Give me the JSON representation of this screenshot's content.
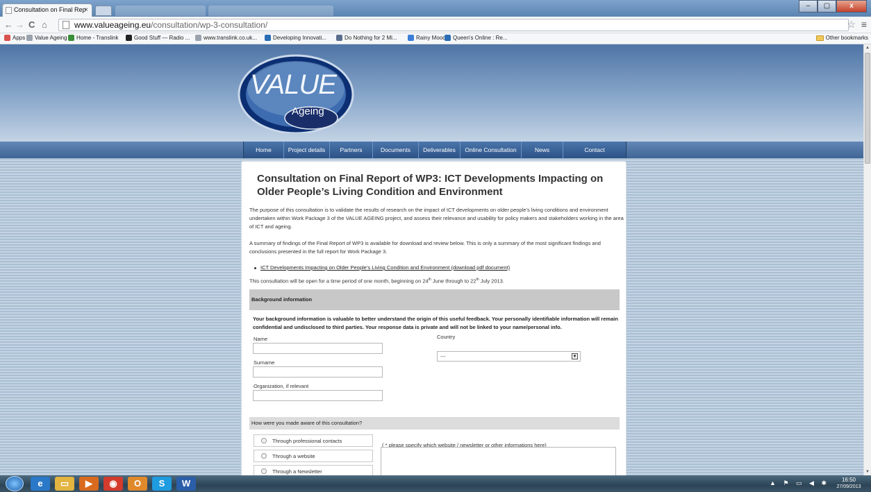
{
  "browser": {
    "tab_title": "Consultation on Final Rep",
    "tab_close": "×",
    "url_host": "www.valueageing.eu",
    "url_path": "/consultation/wp-3-consultation/",
    "bookmarks": [
      {
        "label": "Apps",
        "color": "#d9534f"
      },
      {
        "label": "Value Ageing",
        "color": "#9aa3ad"
      },
      {
        "label": "Home - Translink",
        "color": "#3a8f3a"
      },
      {
        "label": "Good Stuff — Radio ...",
        "color": "#222222"
      },
      {
        "label": "www.translink.co.uk...",
        "color": "#9aa3ad"
      },
      {
        "label": "Developing Innovati...",
        "color": "#2a6db5"
      },
      {
        "label": "Do Nothing for 2 Mi...",
        "color": "#5a6f8f"
      },
      {
        "label": "Rainy Mood",
        "color": "#3b7dd8"
      },
      {
        "label": "Queen's Online : Re...",
        "color": "#2a6db5"
      }
    ],
    "other_bookmarks": "Other bookmarks"
  },
  "site": {
    "logo_top": "VALUE",
    "logo_bottom": "Ageing",
    "nav": [
      "Home",
      "Project details",
      "Partners",
      "Documents",
      "Deliverables",
      "Online Consultation",
      "News",
      "Contact"
    ]
  },
  "page": {
    "title": "Consultation on Final Report of WP3: ICT Developments Impacting on Older People’s Living Condition and Environment",
    "intro": "The purpose of this consultation is to validate the results of research on the impact of ICT developments on older people’s living conditions and environment undertaken within Work Package 3 of the VALUE AGEING project, and assess their relevance and usability for policy makers and stakeholders working in the area of ICT and ageing.",
    "summary": "A summary of findings of the Final Report of WP3 is available for download and review below. This is only a summary of the most significant findings and conclusions presented in the full report for Work Package 3.",
    "download_link": "ICT Developments Impacting on Older People’s Living Condition and Environment (download pdf document)",
    "open_pre": "This consultation will be open for a time period of one month, beginning on 24",
    "open_sup1": "th",
    "open_mid": " June through to 22",
    "open_sup2": "th",
    "open_post": " July 2013.",
    "background_heading": "Background information",
    "background_note": "Your background information is valuable to better understand the origin of this useful feedback. Your personally identifiable information will remain confidential and undisclosed to third parties. Your response data is private and will not be linked to your name/personal info.",
    "fields": {
      "name_label": "Name",
      "surname_label": "Surname",
      "organization_label": "Organization, if relevant",
      "country_label": "Country",
      "country_value": "---"
    },
    "aware_question": "How were you made aware of this consultation?",
    "aware_options": [
      "Through professional contacts",
      "Through a website",
      "Through a Newsletter"
    ],
    "specify_note": "( * please specify which website / newsletter or other informations here)"
  },
  "taskbar": {
    "time": "16:50",
    "date": "27/09/2013",
    "apps": [
      {
        "name": "ie-icon",
        "glyph": "e",
        "color": "#2a78c8"
      },
      {
        "name": "explorer-icon",
        "glyph": "▭",
        "color": "#e3b440"
      },
      {
        "name": "media-player-icon",
        "glyph": "▶",
        "color": "#d86a1e"
      },
      {
        "name": "chrome-icon",
        "glyph": "◉",
        "color": "#d33b2c"
      },
      {
        "name": "outlook-icon",
        "glyph": "O",
        "color": "#e0892a"
      },
      {
        "name": "skype-icon",
        "glyph": "S",
        "color": "#1f9be0"
      },
      {
        "name": "word-icon",
        "glyph": "W",
        "color": "#2b5ea8"
      }
    ]
  }
}
